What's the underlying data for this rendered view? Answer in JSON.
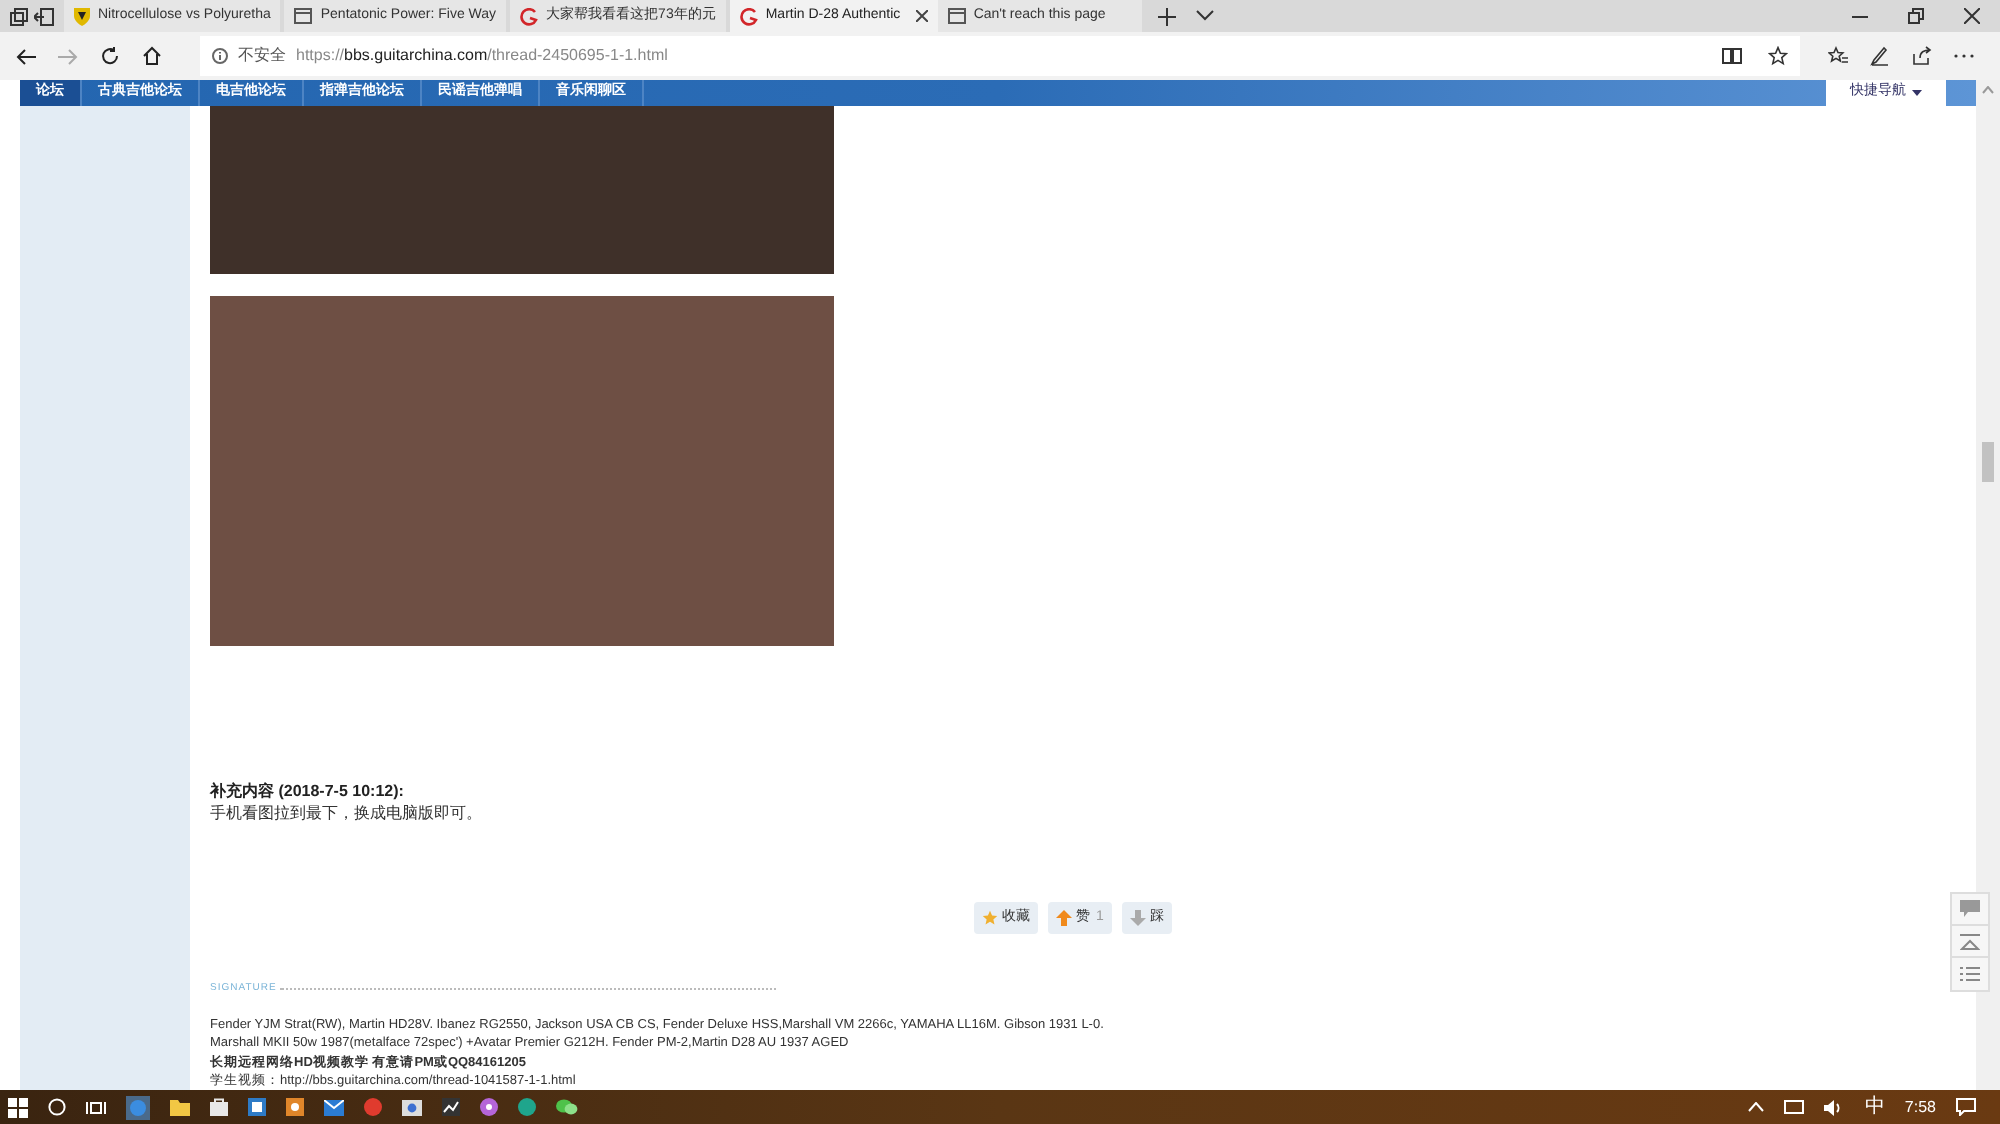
{
  "browser_tabs": [
    {
      "title": "Nitrocellulose vs Polyuretha",
      "kind": "shield",
      "selected": false
    },
    {
      "title": "Pentatonic Power: Five Way",
      "kind": "page",
      "selected": false
    },
    {
      "title": "大家帮我看看这把73年的元",
      "kind": "logo",
      "selected": false
    },
    {
      "title": "Martin D-28 Authentic",
      "kind": "logo",
      "selected": true
    },
    {
      "title": "Can't reach this page",
      "kind": "page",
      "selected": false
    }
  ],
  "address_bar": {
    "security": "不安全",
    "url_prefix": "https://",
    "url_host": "bbs.guitarchina.com",
    "url_path": "/thread-2450695-1-1.html"
  },
  "forum_nav": {
    "items": [
      {
        "label": "论坛",
        "selected": true
      },
      {
        "label": "古典吉他论坛",
        "selected": false
      },
      {
        "label": "电吉他论坛",
        "selected": false
      },
      {
        "label": "指弹吉他论坛",
        "selected": false
      },
      {
        "label": "民谣吉他弹唱",
        "selected": false
      },
      {
        "label": "音乐闲聊区",
        "selected": false
      }
    ],
    "quick_nav": "快捷导航"
  },
  "post": {
    "images": [
      {
        "color": "#3f3029"
      },
      {
        "color": "#6e4f44"
      }
    ],
    "supplement_title": "补充内容 (2018-7-5 10:12):",
    "supplement_text": "手机看图拉到最下，换成电脑版即可。",
    "reactions": [
      {
        "kind": "favorite",
        "label": "收藏"
      },
      {
        "kind": "like",
        "label": "赞",
        "count": "1"
      },
      {
        "kind": "dislike",
        "label": "踩"
      }
    ],
    "signature_heading": "SIGNATURE",
    "signature_lines": [
      {
        "text": "Fender YJM Strat(RW), Martin HD28V.  Ibanez RG2550, Jackson USA CB CS, Fender Deluxe HSS,Marshall VM 2266c, YAMAHA LL16M.  Gibson 1931 L-0.",
        "bold": false
      },
      {
        "text": "Marshall MKII 50w 1987(metalface 72spec') +Avatar Premier G212H.  Fender PM-2,Martin D28 AU 1937 AGED",
        "bold": false
      },
      {
        "text": "长期远程网络HD视频教学 有意请PM或QQ84161205",
        "bold": true
      },
      {
        "text": "学生视频：http://bbs.guitarchina.com/thread-1041587-1-1.html",
        "bold": false
      }
    ]
  },
  "taskbar": {
    "ime": "中",
    "time": "7:58"
  }
}
